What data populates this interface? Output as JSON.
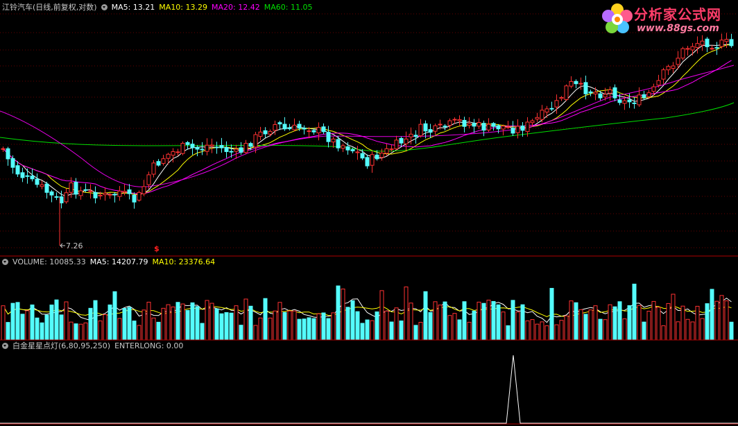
{
  "header": {
    "title": "江铃汽车(日线,前复权,对数)",
    "ma5": "MA5: 13.21",
    "ma10": "MA10: 13.29",
    "ma20": "MA20: 12.42",
    "ma60": "MA60: 11.05"
  },
  "volume_header": {
    "volume": "VOLUME: 10085.33",
    "ma5": "MA5: 14207.79",
    "ma10": "MA10: 23376.64"
  },
  "indicator_header": {
    "name": "白金星星点灯(6,80,95,250)",
    "value": "ENTERLONG: 0.00"
  },
  "annotations": {
    "low_label": "7.26",
    "signal_mark": "$"
  },
  "logo": {
    "name_cn": "分析家公式网",
    "url": "www.88gs.com"
  },
  "colors": {
    "up": "#ff3232",
    "down": "#54fcfc",
    "ma5": "#ffffff",
    "ma10": "#ffff00",
    "ma20": "#ff00ff",
    "ma60": "#00e000",
    "grid": "#8b0000",
    "separator": "#b00000"
  },
  "chart_data": [
    {
      "type": "candlestick",
      "title": "江铃汽车(日线,前复权,对数)",
      "series": [
        {
          "name": "MA5",
          "last": 13.21
        },
        {
          "name": "MA10",
          "last": 13.29
        },
        {
          "name": "MA20",
          "last": 12.42
        },
        {
          "name": "MA60",
          "last": 11.05
        }
      ],
      "annotations": [
        {
          "text": "7.26",
          "meaning": "period low"
        }
      ],
      "grid": true
    },
    {
      "type": "bar",
      "title": "VOLUME",
      "series": [
        {
          "name": "VOLUME",
          "last": 10085.33
        },
        {
          "name": "MA5",
          "last": 14207.79
        },
        {
          "name": "MA10",
          "last": 23376.64
        }
      ]
    },
    {
      "type": "line",
      "title": "白金星星点灯(6,80,95,250)",
      "series": [
        {
          "name": "ENTERLONG",
          "last": 0.0
        }
      ]
    }
  ]
}
